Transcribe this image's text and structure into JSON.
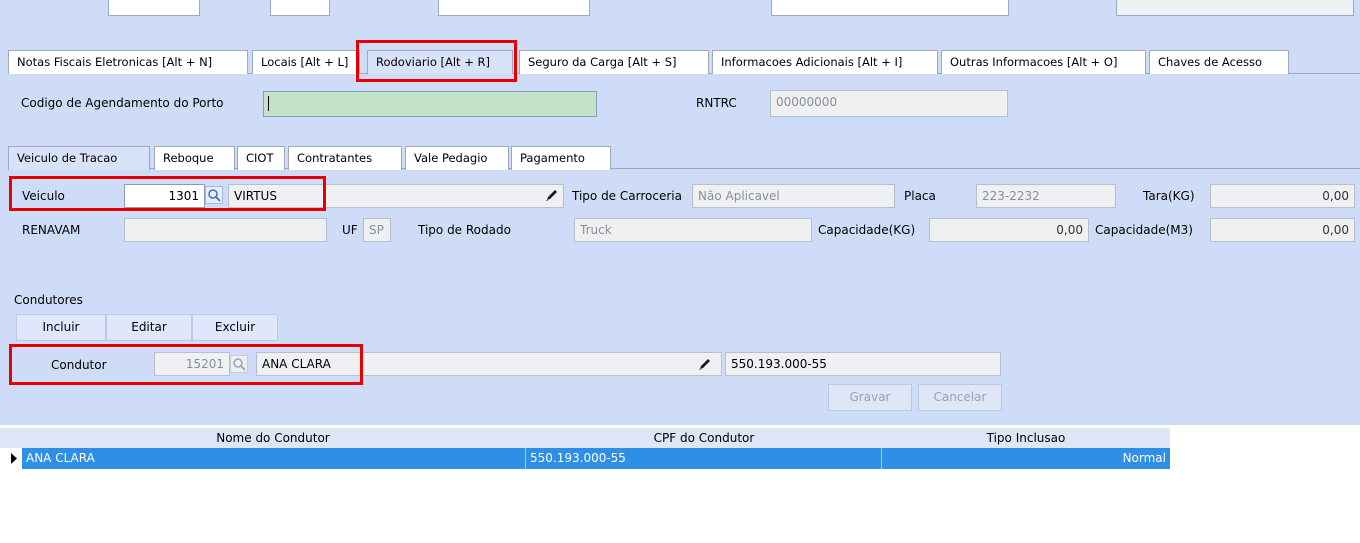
{
  "top_tabs": [
    {
      "label": "Notas Fiscais Eletronicas [Alt + N]"
    },
    {
      "label": "Locais [Alt + L]"
    },
    {
      "label": "Rodoviario [Alt + R]"
    },
    {
      "label": "Seguro da Carga [Alt + S]"
    },
    {
      "label": "Informacoes Adicionais [Alt + I]"
    },
    {
      "label": "Outras Informacoes [Alt + O]"
    },
    {
      "label": "Chaves de Acesso"
    }
  ],
  "agendamento": {
    "label": "Codigo de Agendamento do Porto",
    "value": ""
  },
  "rntrc": {
    "label": "RNTRC",
    "value": "00000000"
  },
  "sub_tabs": [
    {
      "label": "Veiculo de Tracao"
    },
    {
      "label": "Reboque"
    },
    {
      "label": "CIOT"
    },
    {
      "label": "Contratantes"
    },
    {
      "label": "Vale Pedagio"
    },
    {
      "label": "Pagamento"
    }
  ],
  "veiculo": {
    "label": "Veiculo",
    "code": "1301",
    "name": "VIRTUS",
    "tipo_carroceria_label": "Tipo de Carroceria",
    "tipo_carroceria": "Não Aplicavel",
    "placa_label": "Placa",
    "placa": "223-2232",
    "tara_label": "Tara(KG)",
    "tara": "0,00",
    "renavam_label": "RENAVAM",
    "renavam": "",
    "uf_label": "UF",
    "uf": "SP",
    "tipo_rodado_label": "Tipo de Rodado",
    "tipo_rodado": "Truck",
    "capacidade_kg_label": "Capacidade(KG)",
    "capacidade_kg": "0,00",
    "capacidade_m3_label": "Capacidade(M3)",
    "capacidade_m3": "0,00"
  },
  "condutores": {
    "section_label": "Condutores",
    "incluir": "Incluir",
    "editar": "Editar",
    "excluir": "Excluir",
    "condutor_label": "Condutor",
    "condutor_code": "15201",
    "condutor_name": "ANA CLARA",
    "condutor_cpf": "550.193.000-55",
    "gravar": "Gravar",
    "cancelar": "Cancelar"
  },
  "grid": {
    "columns": [
      "Nome do Condutor",
      "CPF do Condutor",
      "Tipo Inclusao"
    ],
    "rows": [
      {
        "nome": "ANA CLARA",
        "cpf": "550.193.000-55",
        "tipo": "Normal"
      }
    ]
  }
}
